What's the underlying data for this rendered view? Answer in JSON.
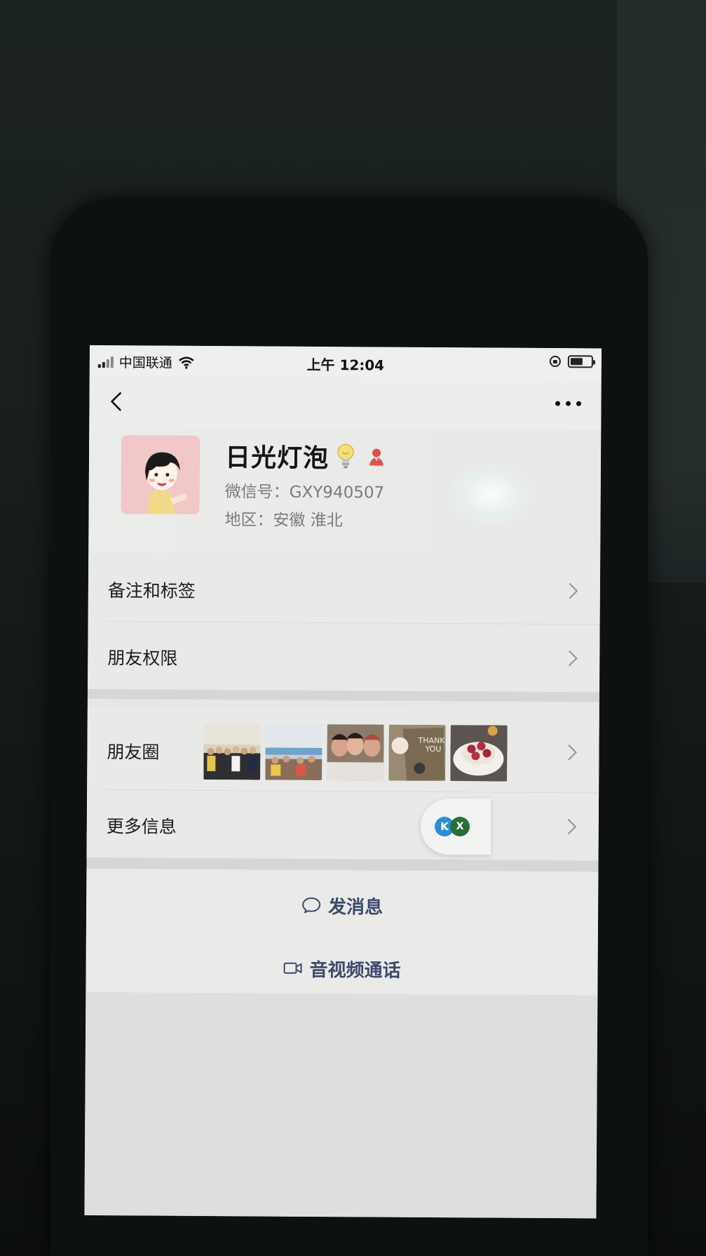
{
  "status_bar": {
    "carrier": "中国联通",
    "time": "上午 12:04"
  },
  "profile": {
    "name": "日光灯泡",
    "wechat_id": "微信号：GXY940507",
    "region": "地区：安徽 淮北"
  },
  "menu": {
    "remarks_label": "备注和标签",
    "permissions_label": "朋友权限",
    "moments_label": "朋友圈",
    "more_info_label": "更多信息"
  },
  "moments_thumbs": [
    "group-photo",
    "banquet-hall-photo",
    "selfie-photo",
    "thank-you-card-photo",
    "cake-photo"
  ],
  "actions": {
    "send_message": "发消息",
    "video_call": "音视频通话"
  },
  "floating_ball": {
    "left_letter": "K",
    "right_letter": "X"
  },
  "colors": {
    "action_text": "#3c4a6c",
    "avatar_bg": "#f0c8c8",
    "gender_icon": "#e0504a"
  }
}
